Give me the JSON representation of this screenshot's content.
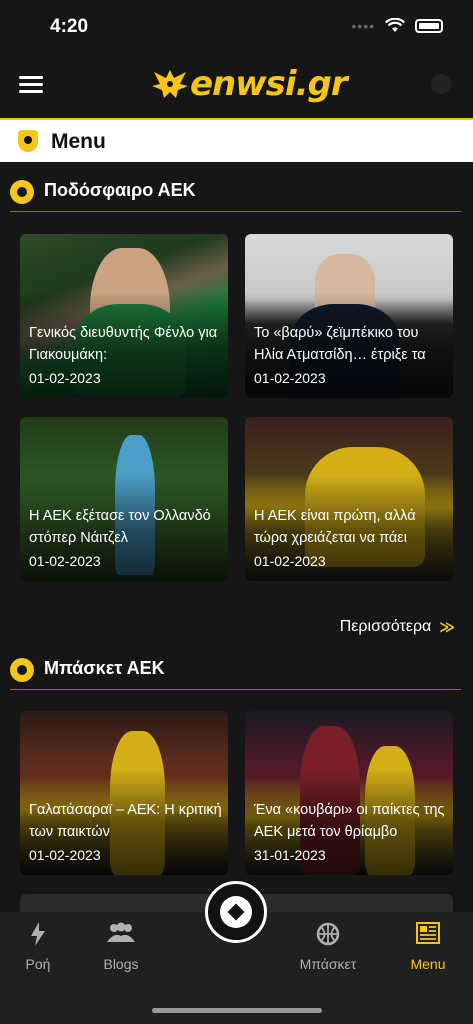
{
  "status": {
    "time": "4:20"
  },
  "header": {
    "logo_text": "enwsi.gr"
  },
  "menu_bar": {
    "title": "Menu"
  },
  "football": {
    "title": "Ποδόσφαιρο ΑΕΚ",
    "more_label": "Περισσότερα",
    "cards": [
      {
        "title": "Γενικός διευθυντής Φένλο για Γιακουμάκη:",
        "date": "01-02-2023"
      },
      {
        "title": "Το «βαρύ» ζεϊμπέκικο του Ηλία Ατματσίδη… έτριξε τα",
        "date": "01-02-2023"
      },
      {
        "title": "Η ΑΕΚ εξέτασε τον Ολλανδό στόπερ Νάιτζελ",
        "date": "01-02-2023"
      },
      {
        "title": "Η ΑΕΚ είναι πρώτη, αλλά τώρα χρειάζεται να πάει",
        "date": "01-02-2023"
      }
    ]
  },
  "basketball": {
    "title": "Μπάσκετ ΑΕΚ",
    "cards": [
      {
        "title": "Γαλατάσαραϊ – ΑΕΚ: Η κριτική των παικτών",
        "date": "01-02-2023"
      },
      {
        "title": "Ένα «κουβάρι» οι παίκτες της ΑΕΚ μετά τον θρίαμβο",
        "date": "31-01-2023"
      }
    ]
  },
  "tabs": [
    {
      "label": "Ροή",
      "icon": "lightning-icon"
    },
    {
      "label": "Blogs",
      "icon": "people-icon"
    },
    {
      "label": "Μπάσκετ",
      "icon": "basketball-icon"
    },
    {
      "label": "Menu",
      "icon": "newspaper-icon",
      "active": true
    }
  ],
  "colors": {
    "accent": "#f5c518",
    "background": "#161616"
  }
}
